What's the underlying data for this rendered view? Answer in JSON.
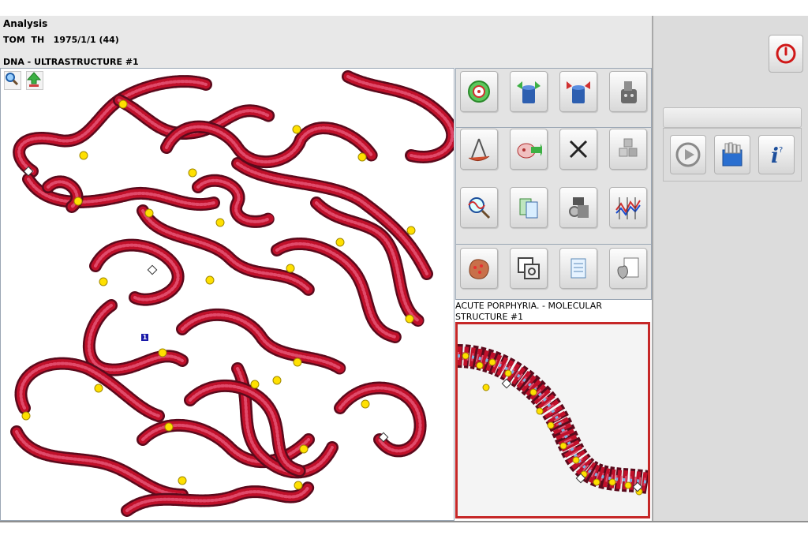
{
  "header": {
    "title": "Analysis",
    "patient_name": "TOM  TH",
    "patient_dob": "1975/1/1 (44)",
    "section_label": "DNA - ULTRASTRUCTURE #1"
  },
  "main_view": {
    "tools": [
      {
        "icon": "zoom-icon"
      },
      {
        "icon": "upload-arrow-icon"
      }
    ],
    "marker_label": "1"
  },
  "toolbar": {
    "buttons": [
      {
        "icon": "target-icon"
      },
      {
        "icon": "cylinder-green-arrows-icon"
      },
      {
        "icon": "cylinder-red-arrows-icon"
      },
      {
        "icon": "device-icon"
      },
      {
        "icon": "compass-icon"
      },
      {
        "icon": "cell-arrow-icon"
      },
      {
        "icon": "close-icon"
      },
      {
        "icon": "cubes-icon"
      },
      {
        "icon": "magnifier-wave-icon"
      },
      {
        "icon": "documents-icon"
      },
      {
        "icon": "gears-print-icon"
      },
      {
        "icon": "graph-icon"
      },
      {
        "icon": "organ-icon"
      },
      {
        "icon": "window-zoom-icon"
      },
      {
        "icon": "notes-icon"
      },
      {
        "icon": "heart-report-icon"
      }
    ]
  },
  "sub_view": {
    "label": "ACUTE PORPHYRIA. - MOLECULAR STRUCTURE #1"
  },
  "right_panel": {
    "power_icon": "power-icon",
    "bar_text": "",
    "buttons": [
      {
        "icon": "play-icon"
      },
      {
        "icon": "database-icon"
      },
      {
        "icon": "info-icon"
      }
    ]
  },
  "colors": {
    "dna_red": "#c0102a",
    "dna_dark": "#5a0a1c",
    "marker_yellow": "#ffe000",
    "frame_red": "#c62828",
    "panel_grey": "#e3e3e3"
  }
}
